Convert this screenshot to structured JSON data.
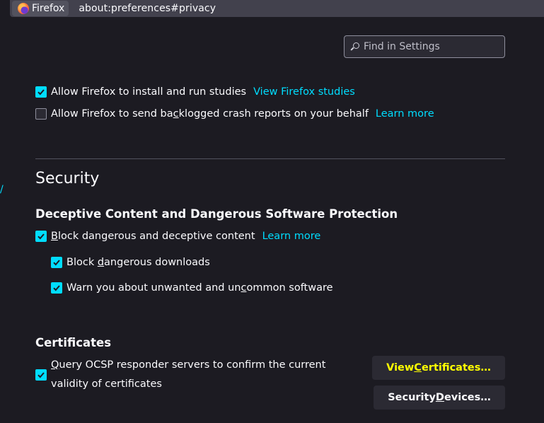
{
  "browser": {
    "identity_label": "Firefox",
    "url": "about:preferences#privacy"
  },
  "search": {
    "placeholder": "Find in Settings"
  },
  "studies": {
    "label": "Allow Firefox to install and run studies",
    "checked": true,
    "link": "View Firefox studies"
  },
  "crash_reports": {
    "label_pre": "Allow Firefox to send ba",
    "label_accel": "c",
    "label_post": "klogged crash reports on your behalf",
    "checked": false,
    "link": "Learn more"
  },
  "left_mark": "/",
  "security": {
    "title": "Security",
    "deceptive": {
      "heading": "Deceptive Content and Dangerous Software Protection",
      "block_content": {
        "accel": "B",
        "label_post": "lock dangerous and deceptive content",
        "checked": true,
        "link": "Learn more"
      },
      "block_downloads": {
        "label_pre": "Block ",
        "accel": "d",
        "label_post": "angerous downloads",
        "checked": true
      },
      "warn_unwanted": {
        "label_pre": "Warn you about unwanted and un",
        "accel": "c",
        "label_post": "ommon software",
        "checked": true
      }
    },
    "certificates": {
      "heading": "Certificates",
      "ocsp": {
        "accel": "Q",
        "line1_post": "uery OCSP responder servers to confirm the current",
        "line2": "validity of certificates",
        "checked": true
      },
      "view_certs": {
        "label_pre": "View ",
        "accel": "C",
        "label_post": "ertificates…"
      },
      "security_devices": {
        "label_pre": "Security ",
        "accel": "D",
        "label_post": "evices…"
      }
    }
  },
  "colors": {
    "accent": "#00ddff",
    "background": "#1c1b22",
    "highlight": "#ffff00"
  }
}
